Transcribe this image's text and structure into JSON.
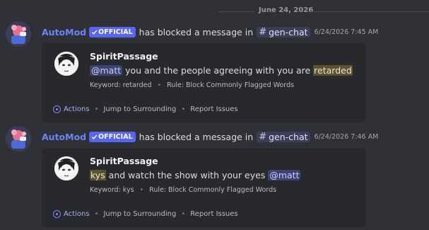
{
  "divider": {
    "date": "June 24, 2026"
  },
  "messages": [
    {
      "author": "AutoMod",
      "badge": "OFFICIAL",
      "badge_icon": "check-icon",
      "action": "has blocked a message in",
      "channel": "gen-chat",
      "channel_icon": "hash-icon",
      "timestamp": "6/24/2026 7:45 AM",
      "card": {
        "username": "SpiritPassage",
        "segments": [
          {
            "type": "mention",
            "text": "@matt"
          },
          {
            "type": "text",
            "text": " you and the people agreeing with you are "
          },
          {
            "type": "flagged",
            "text": "retarded"
          }
        ],
        "keyword": "Keyword: retarded",
        "rule": "Rule: Block Commonly Flagged Words",
        "actions": {
          "actions_label": "Actions",
          "jump_label": "Jump to Surrounding",
          "report_label": "Report Issues"
        }
      }
    },
    {
      "author": "AutoMod",
      "badge": "OFFICIAL",
      "badge_icon": "check-icon",
      "action": "has blocked a message in",
      "channel": "gen-chat",
      "channel_icon": "hash-icon",
      "timestamp": "6/24/2026 7:46 AM",
      "card": {
        "username": "SpiritPassage",
        "segments": [
          {
            "type": "flagged",
            "text": "kys"
          },
          {
            "type": "text",
            "text": " and watch the show with your eyes "
          },
          {
            "type": "mention",
            "text": "@matt"
          }
        ],
        "keyword": "Keyword: kys",
        "rule": "Rule: Block Commonly Flagged Words",
        "actions": {
          "actions_label": "Actions",
          "jump_label": "Jump to Surrounding",
          "report_label": "Report Issues"
        }
      }
    }
  ],
  "colors": {
    "background": "#2f3136",
    "card": "#27292d",
    "author": "#6d84f4",
    "official_badge": "#5865f2",
    "mention_bg": "#3d4270",
    "flagged_bg": "#5c5230"
  }
}
